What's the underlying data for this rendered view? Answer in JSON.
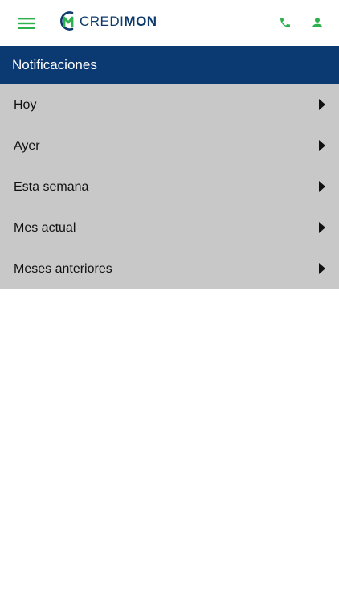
{
  "header": {
    "logo": {
      "text_light": "CREDI",
      "text_bold": "MON",
      "mark_letter": "M"
    },
    "icons": {
      "menu": "hamburger-menu-icon",
      "phone": "phone-icon",
      "user": "user-icon"
    },
    "icon_color": "#2bb24c",
    "brand_color": "#0d3a6b"
  },
  "titlebar": {
    "title": "Notificaciones",
    "background": "#0b3a73"
  },
  "list": {
    "background": "#c8c8c8",
    "items": [
      {
        "label": "Hoy"
      },
      {
        "label": "Ayer"
      },
      {
        "label": "Esta semana"
      },
      {
        "label": "Mes actual"
      },
      {
        "label": "Meses anteriores"
      }
    ]
  }
}
